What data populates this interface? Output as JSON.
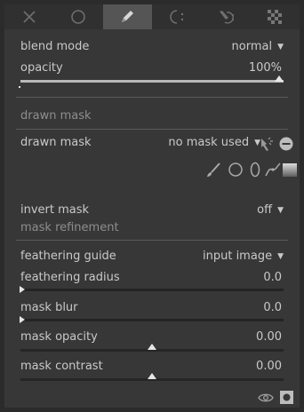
{
  "tabs": [
    {
      "name": "off",
      "icon": "close-icon"
    },
    {
      "name": "uniform",
      "icon": "circle-icon"
    },
    {
      "name": "drawn",
      "icon": "pencil-icon",
      "active": true
    },
    {
      "name": "parametric",
      "icon": "parametric-icon"
    },
    {
      "name": "drawn-parametric",
      "icon": "drawn-parametric-icon"
    },
    {
      "name": "raster",
      "icon": "checkerboard-icon"
    }
  ],
  "blend_mode": {
    "label": "blend mode",
    "value": "normal"
  },
  "opacity": {
    "label": "opacity",
    "value": "100%",
    "level": 1.0
  },
  "drawn_mask_section": "drawn mask",
  "drawn_mask": {
    "label": "drawn mask",
    "value": "no mask used"
  },
  "shape_icons": [
    "brush-icon",
    "circle-shape-icon",
    "ellipse-shape-icon",
    "path-icon",
    "gradient-icon"
  ],
  "invert_mask": {
    "label": "invert mask",
    "value": "off"
  },
  "mask_refinement_section": "mask refinement",
  "feathering_guide": {
    "label": "feathering guide",
    "value": "input image"
  },
  "feathering_radius": {
    "label": "feathering radius",
    "value": "0.0",
    "level": 0.0
  },
  "mask_blur": {
    "label": "mask blur",
    "value": "0.0",
    "level": 0.0
  },
  "mask_opacity": {
    "label": "mask opacity",
    "value": "0.00",
    "level": 0.5
  },
  "mask_contrast": {
    "label": "mask contrast",
    "value": "0.00",
    "level": 0.5
  },
  "colors": {
    "background": "#373737",
    "text": "#c9c9c9",
    "section": "#8e8e8e",
    "active_tab": "#555555"
  }
}
